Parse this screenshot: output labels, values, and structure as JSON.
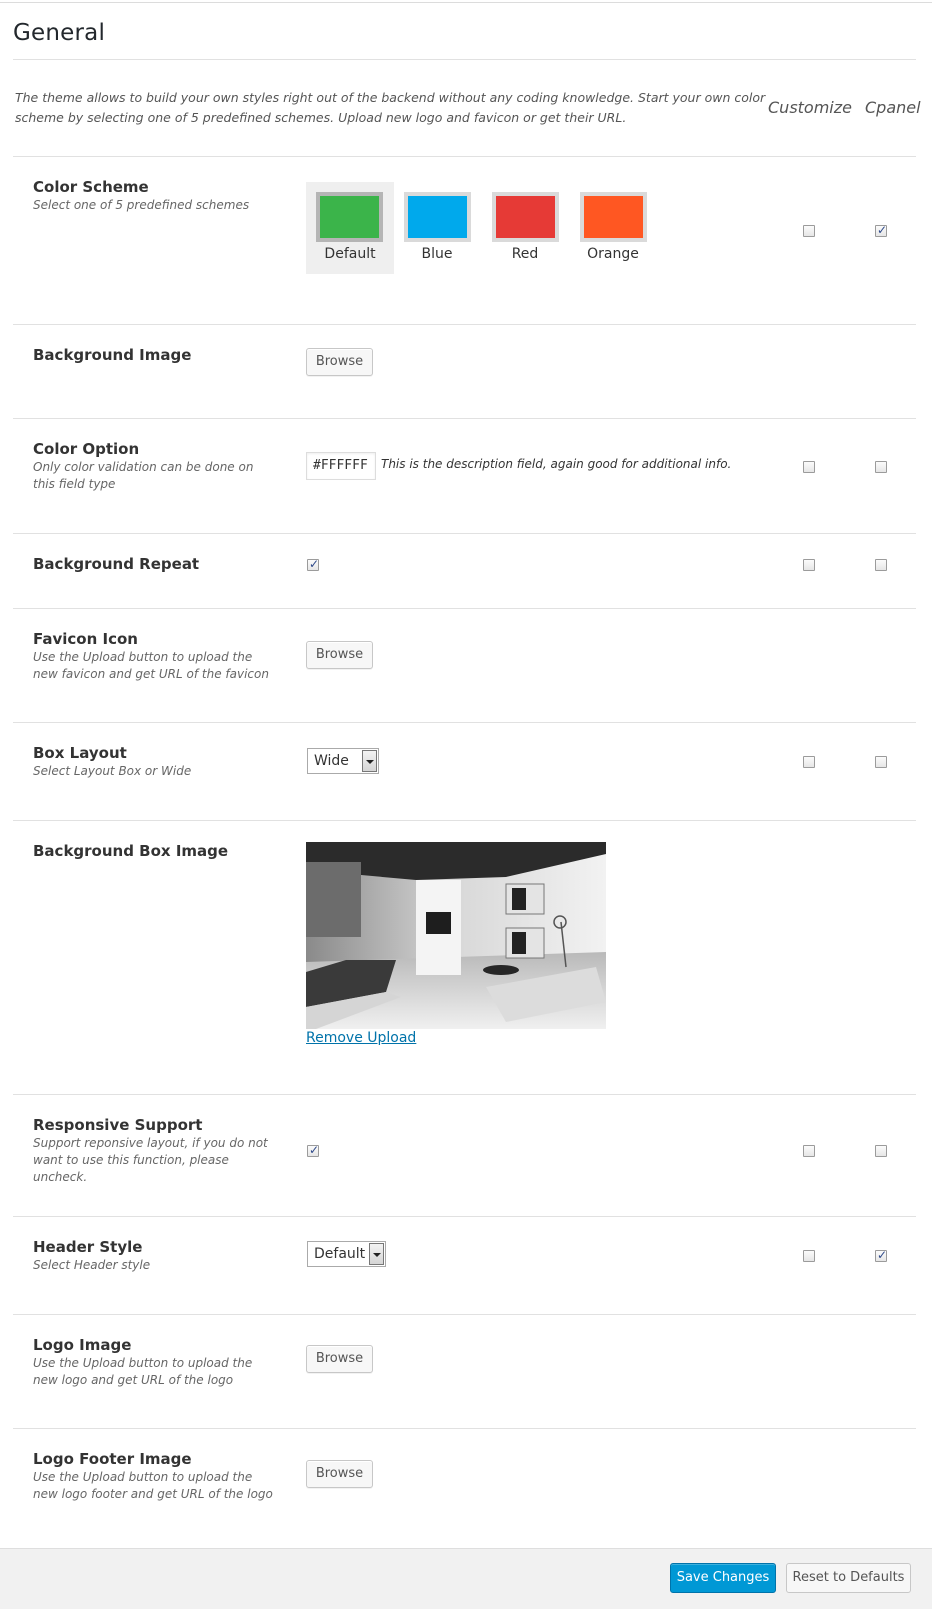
{
  "page": {
    "title": "General",
    "intro": "The theme allows to build your own styles right out of the backend without any coding knowledge. Start your own color scheme by selecting one of 5 predefined schemes. Upload new logo and favicon or get their URL.",
    "columns": {
      "customize": "Customize",
      "cpanel": "Cpanel"
    }
  },
  "color_scheme": {
    "label": "Color Scheme",
    "desc": "Select one of 5 predefined schemes",
    "options": [
      {
        "label": "Default",
        "color": "#3bb44a",
        "selected": true
      },
      {
        "label": "Blue",
        "color": "#00a9ec",
        "selected": false
      },
      {
        "label": "Red",
        "color": "#e63a36",
        "selected": false
      },
      {
        "label": "Orange",
        "color": "#ff5722",
        "selected": false
      }
    ],
    "customize": false,
    "cpanel": true
  },
  "background_image": {
    "label": "Background Image",
    "button": "Browse"
  },
  "color_option": {
    "label": "Color Option",
    "desc": "Only color validation can be done on this field type",
    "value": "#FFFFFF",
    "field_desc": "This is the description field, again good for additional info.",
    "customize": false,
    "cpanel": false
  },
  "background_repeat": {
    "label": "Background Repeat",
    "checked": true,
    "customize": false,
    "cpanel": false
  },
  "favicon_icon": {
    "label": "Favicon Icon",
    "desc": "Use the Upload button to upload the new favicon and get URL of the favicon",
    "button": "Browse"
  },
  "box_layout": {
    "label": "Box Layout",
    "desc": "Select Layout Box or Wide",
    "value": "Wide",
    "customize": false,
    "cpanel": false
  },
  "background_box_image": {
    "label": "Background Box Image",
    "remove_label": "Remove Upload"
  },
  "responsive_support": {
    "label": "Responsive Support",
    "desc": "Support reponsive layout, if you do not want to use this function, please uncheck.",
    "checked": true,
    "customize": false,
    "cpanel": false
  },
  "header_style": {
    "label": "Header Style",
    "desc": "Select Header style",
    "value": "Default",
    "customize": false,
    "cpanel": true
  },
  "logo_image": {
    "label": "Logo Image",
    "desc": "Use the Upload button to upload the new logo and get URL of the logo",
    "button": "Browse"
  },
  "logo_footer_image": {
    "label": "Logo Footer Image",
    "desc": "Use the Upload button to upload the new logo footer and get URL of the logo",
    "button": "Browse"
  },
  "footer": {
    "save": "Save Changes",
    "reset": "Reset to Defaults"
  }
}
